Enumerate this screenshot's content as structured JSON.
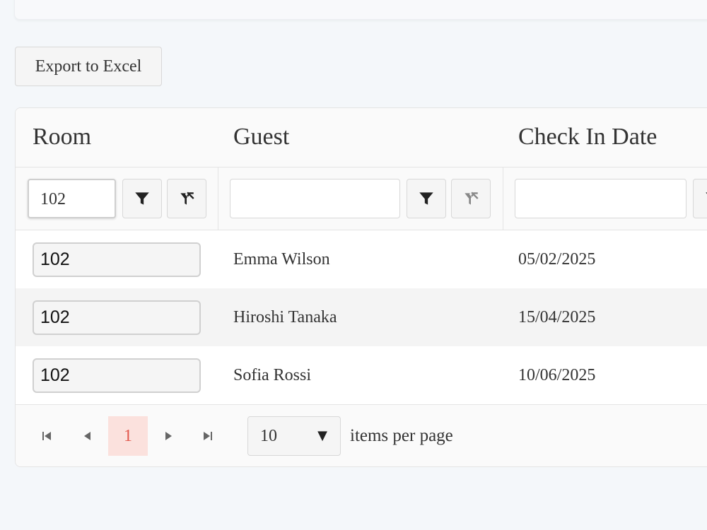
{
  "toolbar": {
    "export_label": "Export to Excel"
  },
  "grid": {
    "columns": [
      {
        "label": "Room"
      },
      {
        "label": "Guest"
      },
      {
        "label": "Check In Date"
      }
    ],
    "filters": {
      "room_value": "102",
      "guest_value": "",
      "checkin_value": ""
    },
    "rows": [
      {
        "room": "102",
        "guest": "Emma Wilson",
        "check_in": "05/02/2025"
      },
      {
        "room": "102",
        "guest": "Hiroshi Tanaka",
        "check_in": "15/04/2025"
      },
      {
        "room": "102",
        "guest": "Sofia Rossi",
        "check_in": "10/06/2025"
      }
    ]
  },
  "pager": {
    "current_page": "1",
    "page_size": "10",
    "items_per_page_label": "items per page",
    "accent_color": "#e2574c"
  }
}
